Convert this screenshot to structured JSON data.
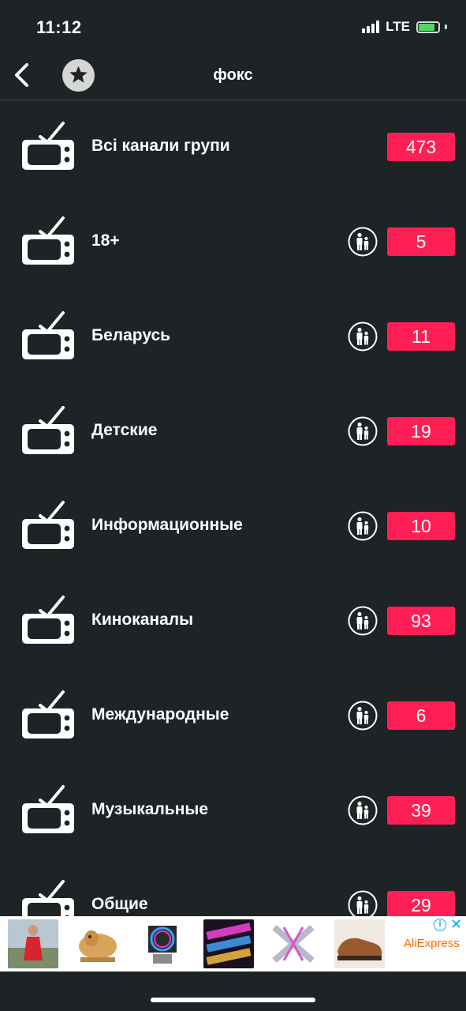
{
  "status_bar": {
    "time": "11:12",
    "network": "LTE",
    "battery_color": "#4cd964"
  },
  "nav": {
    "title": "фокс",
    "back_icon": "chevron-left-icon",
    "favorite_icon": "star-icon"
  },
  "accent_color": "#ff1f55",
  "channel_groups": [
    {
      "label": "Всі канали групи",
      "count": "473",
      "has_family_icon": false
    },
    {
      "label": "18+",
      "count": "5",
      "has_family_icon": true
    },
    {
      "label": "Беларусь",
      "count": "11",
      "has_family_icon": true
    },
    {
      "label": "Детские",
      "count": "19",
      "has_family_icon": true
    },
    {
      "label": "Информационные",
      "count": "10",
      "has_family_icon": true
    },
    {
      "label": "Киноканалы",
      "count": "93",
      "has_family_icon": true
    },
    {
      "label": "Международные",
      "count": "6",
      "has_family_icon": true
    },
    {
      "label": "Музыкальные",
      "count": "39",
      "has_family_icon": true
    },
    {
      "label": "Общие",
      "count": "29",
      "has_family_icon": true
    }
  ],
  "ad": {
    "brand": "AliExpress",
    "info_icon": "info-icon",
    "close_icon": "close-icon"
  }
}
